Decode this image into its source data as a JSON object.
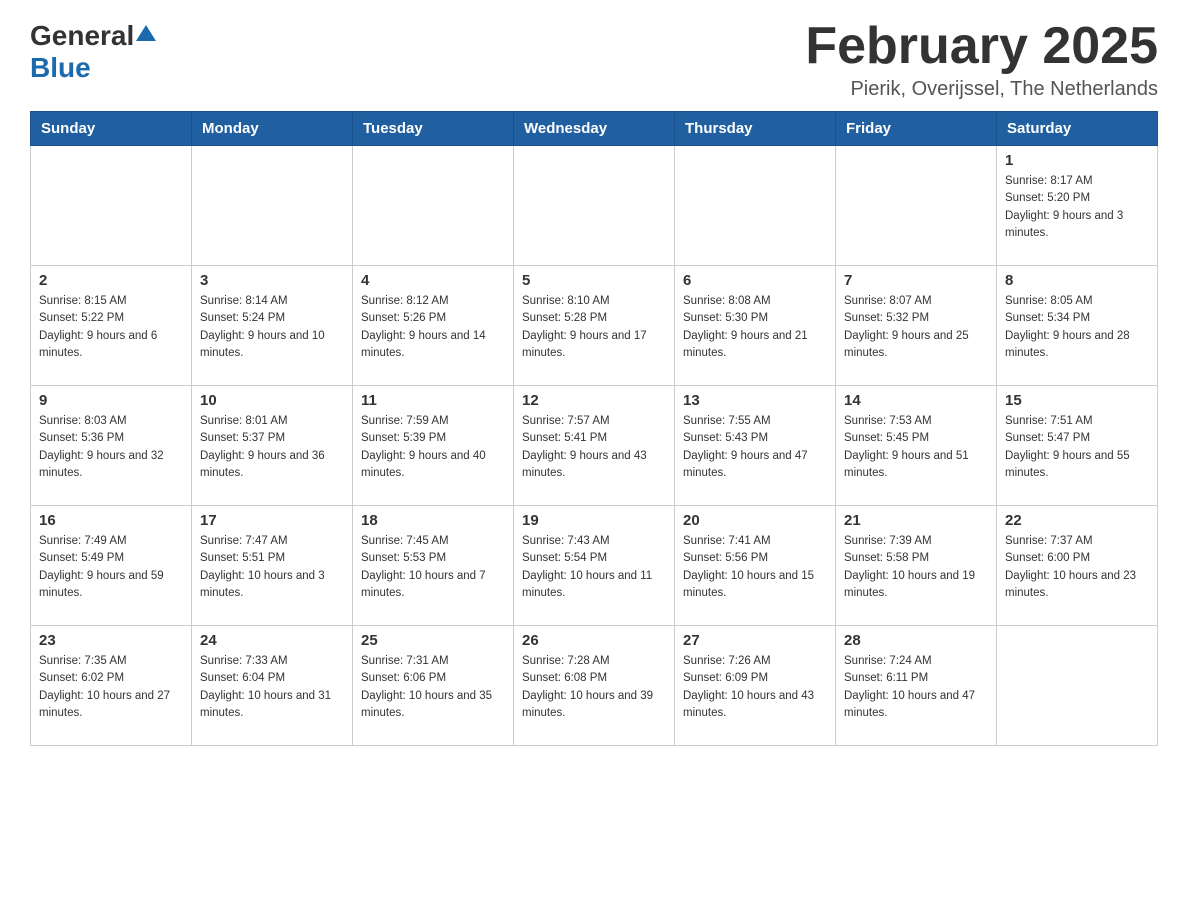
{
  "header": {
    "logo": {
      "general": "General",
      "blue": "Blue"
    },
    "title": "February 2025",
    "location": "Pierik, Overijssel, The Netherlands"
  },
  "calendar": {
    "days_of_week": [
      "Sunday",
      "Monday",
      "Tuesday",
      "Wednesday",
      "Thursday",
      "Friday",
      "Saturday"
    ],
    "weeks": [
      [
        {
          "day": "",
          "info": ""
        },
        {
          "day": "",
          "info": ""
        },
        {
          "day": "",
          "info": ""
        },
        {
          "day": "",
          "info": ""
        },
        {
          "day": "",
          "info": ""
        },
        {
          "day": "",
          "info": ""
        },
        {
          "day": "1",
          "info": "Sunrise: 8:17 AM\nSunset: 5:20 PM\nDaylight: 9 hours and 3 minutes."
        }
      ],
      [
        {
          "day": "2",
          "info": "Sunrise: 8:15 AM\nSunset: 5:22 PM\nDaylight: 9 hours and 6 minutes."
        },
        {
          "day": "3",
          "info": "Sunrise: 8:14 AM\nSunset: 5:24 PM\nDaylight: 9 hours and 10 minutes."
        },
        {
          "day": "4",
          "info": "Sunrise: 8:12 AM\nSunset: 5:26 PM\nDaylight: 9 hours and 14 minutes."
        },
        {
          "day": "5",
          "info": "Sunrise: 8:10 AM\nSunset: 5:28 PM\nDaylight: 9 hours and 17 minutes."
        },
        {
          "day": "6",
          "info": "Sunrise: 8:08 AM\nSunset: 5:30 PM\nDaylight: 9 hours and 21 minutes."
        },
        {
          "day": "7",
          "info": "Sunrise: 8:07 AM\nSunset: 5:32 PM\nDaylight: 9 hours and 25 minutes."
        },
        {
          "day": "8",
          "info": "Sunrise: 8:05 AM\nSunset: 5:34 PM\nDaylight: 9 hours and 28 minutes."
        }
      ],
      [
        {
          "day": "9",
          "info": "Sunrise: 8:03 AM\nSunset: 5:36 PM\nDaylight: 9 hours and 32 minutes."
        },
        {
          "day": "10",
          "info": "Sunrise: 8:01 AM\nSunset: 5:37 PM\nDaylight: 9 hours and 36 minutes."
        },
        {
          "day": "11",
          "info": "Sunrise: 7:59 AM\nSunset: 5:39 PM\nDaylight: 9 hours and 40 minutes."
        },
        {
          "day": "12",
          "info": "Sunrise: 7:57 AM\nSunset: 5:41 PM\nDaylight: 9 hours and 43 minutes."
        },
        {
          "day": "13",
          "info": "Sunrise: 7:55 AM\nSunset: 5:43 PM\nDaylight: 9 hours and 47 minutes."
        },
        {
          "day": "14",
          "info": "Sunrise: 7:53 AM\nSunset: 5:45 PM\nDaylight: 9 hours and 51 minutes."
        },
        {
          "day": "15",
          "info": "Sunrise: 7:51 AM\nSunset: 5:47 PM\nDaylight: 9 hours and 55 minutes."
        }
      ],
      [
        {
          "day": "16",
          "info": "Sunrise: 7:49 AM\nSunset: 5:49 PM\nDaylight: 9 hours and 59 minutes."
        },
        {
          "day": "17",
          "info": "Sunrise: 7:47 AM\nSunset: 5:51 PM\nDaylight: 10 hours and 3 minutes."
        },
        {
          "day": "18",
          "info": "Sunrise: 7:45 AM\nSunset: 5:53 PM\nDaylight: 10 hours and 7 minutes."
        },
        {
          "day": "19",
          "info": "Sunrise: 7:43 AM\nSunset: 5:54 PM\nDaylight: 10 hours and 11 minutes."
        },
        {
          "day": "20",
          "info": "Sunrise: 7:41 AM\nSunset: 5:56 PM\nDaylight: 10 hours and 15 minutes."
        },
        {
          "day": "21",
          "info": "Sunrise: 7:39 AM\nSunset: 5:58 PM\nDaylight: 10 hours and 19 minutes."
        },
        {
          "day": "22",
          "info": "Sunrise: 7:37 AM\nSunset: 6:00 PM\nDaylight: 10 hours and 23 minutes."
        }
      ],
      [
        {
          "day": "23",
          "info": "Sunrise: 7:35 AM\nSunset: 6:02 PM\nDaylight: 10 hours and 27 minutes."
        },
        {
          "day": "24",
          "info": "Sunrise: 7:33 AM\nSunset: 6:04 PM\nDaylight: 10 hours and 31 minutes."
        },
        {
          "day": "25",
          "info": "Sunrise: 7:31 AM\nSunset: 6:06 PM\nDaylight: 10 hours and 35 minutes."
        },
        {
          "day": "26",
          "info": "Sunrise: 7:28 AM\nSunset: 6:08 PM\nDaylight: 10 hours and 39 minutes."
        },
        {
          "day": "27",
          "info": "Sunrise: 7:26 AM\nSunset: 6:09 PM\nDaylight: 10 hours and 43 minutes."
        },
        {
          "day": "28",
          "info": "Sunrise: 7:24 AM\nSunset: 6:11 PM\nDaylight: 10 hours and 47 minutes."
        },
        {
          "day": "",
          "info": ""
        }
      ]
    ]
  }
}
